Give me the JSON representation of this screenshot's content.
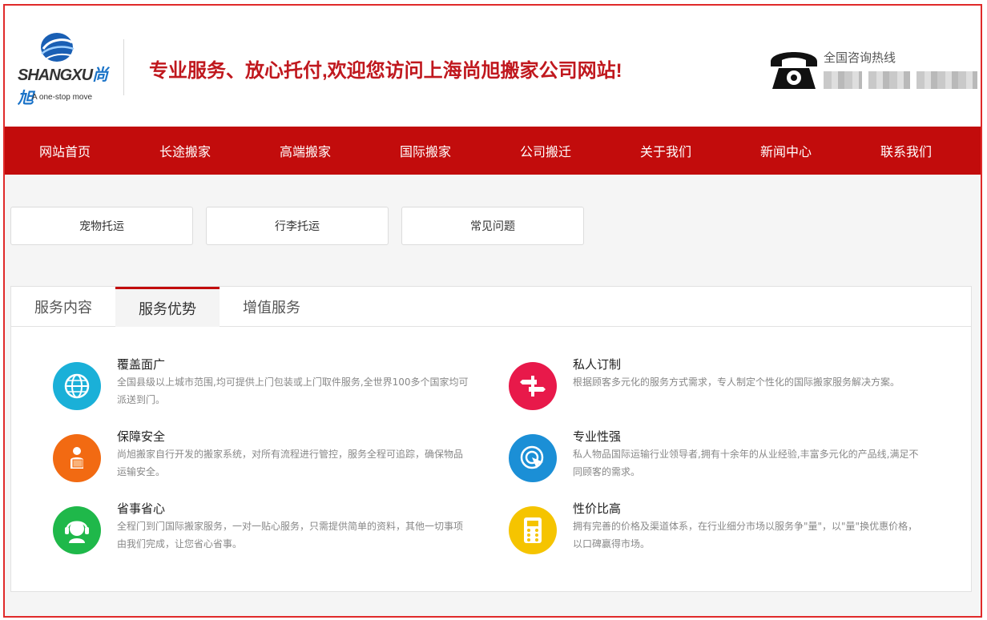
{
  "header": {
    "logo_text_a": "SHANGXU",
    "logo_text_b": "尚旭",
    "logo_tagline": "A one-stop move",
    "slogan": "专业服务、放心托付,欢迎您访问上海尚旭搬家公司网站!",
    "hotline_label": "全国咨询热线"
  },
  "nav": {
    "items": [
      {
        "label": "网站首页"
      },
      {
        "label": "长途搬家"
      },
      {
        "label": "高端搬家"
      },
      {
        "label": "国际搬家"
      },
      {
        "label": "公司搬迁"
      },
      {
        "label": "关于我们"
      },
      {
        "label": "新闻中心"
      },
      {
        "label": "联系我们"
      }
    ]
  },
  "quick_links": [
    {
      "label": "宠物托运"
    },
    {
      "label": "行李托运"
    },
    {
      "label": "常见问题"
    }
  ],
  "tabs": [
    {
      "label": "服务内容",
      "active": false
    },
    {
      "label": "服务优势",
      "active": true
    },
    {
      "label": "增值服务",
      "active": false
    }
  ],
  "features": [
    {
      "title": "覆盖面广",
      "desc": "全国县级以上城市范围,均可提供上门包装或上门取件服务,全世界100多个国家均可派送到门。",
      "icon": "globe-icon",
      "color": "#1ab0d8"
    },
    {
      "title": "私人订制",
      "desc": "根据顾客多元化的服务方式需求，专人制定个性化的国际搬家服务解决方案。",
      "icon": "signpost-icon",
      "color": "#e8194a"
    },
    {
      "title": "保障安全",
      "desc": "尚旭搬家自行开发的搬家系统，对所有流程进行管控，服务全程可追踪，确保物品运输安全。",
      "icon": "delivery-person-icon",
      "color": "#f26a12"
    },
    {
      "title": "专业性强",
      "desc": "私人物品国际运输行业领导者,拥有十余年的从业经验,丰富多元化的产品线,满足不同顾客的需求。",
      "icon": "target-cursor-icon",
      "color": "#1b8fd6"
    },
    {
      "title": "省事省心",
      "desc": "全程门到门国际搬家服务，一对一贴心服务，只需提供简单的资料，其他一切事项由我们完成，让您省心省事。",
      "icon": "headset-agent-icon",
      "color": "#1fb84a"
    },
    {
      "title": "性价比高",
      "desc": "拥有完善的价格及渠道体系，在行业细分市场以服务争\"量\"，以\"量\"换优惠价格，以口碑赢得市场。",
      "icon": "calculator-icon",
      "color": "#f5c400"
    }
  ],
  "colors": {
    "brand_red": "#c20c0c",
    "frame_red": "#e02a2a",
    "slogan_red": "#c0181e"
  }
}
